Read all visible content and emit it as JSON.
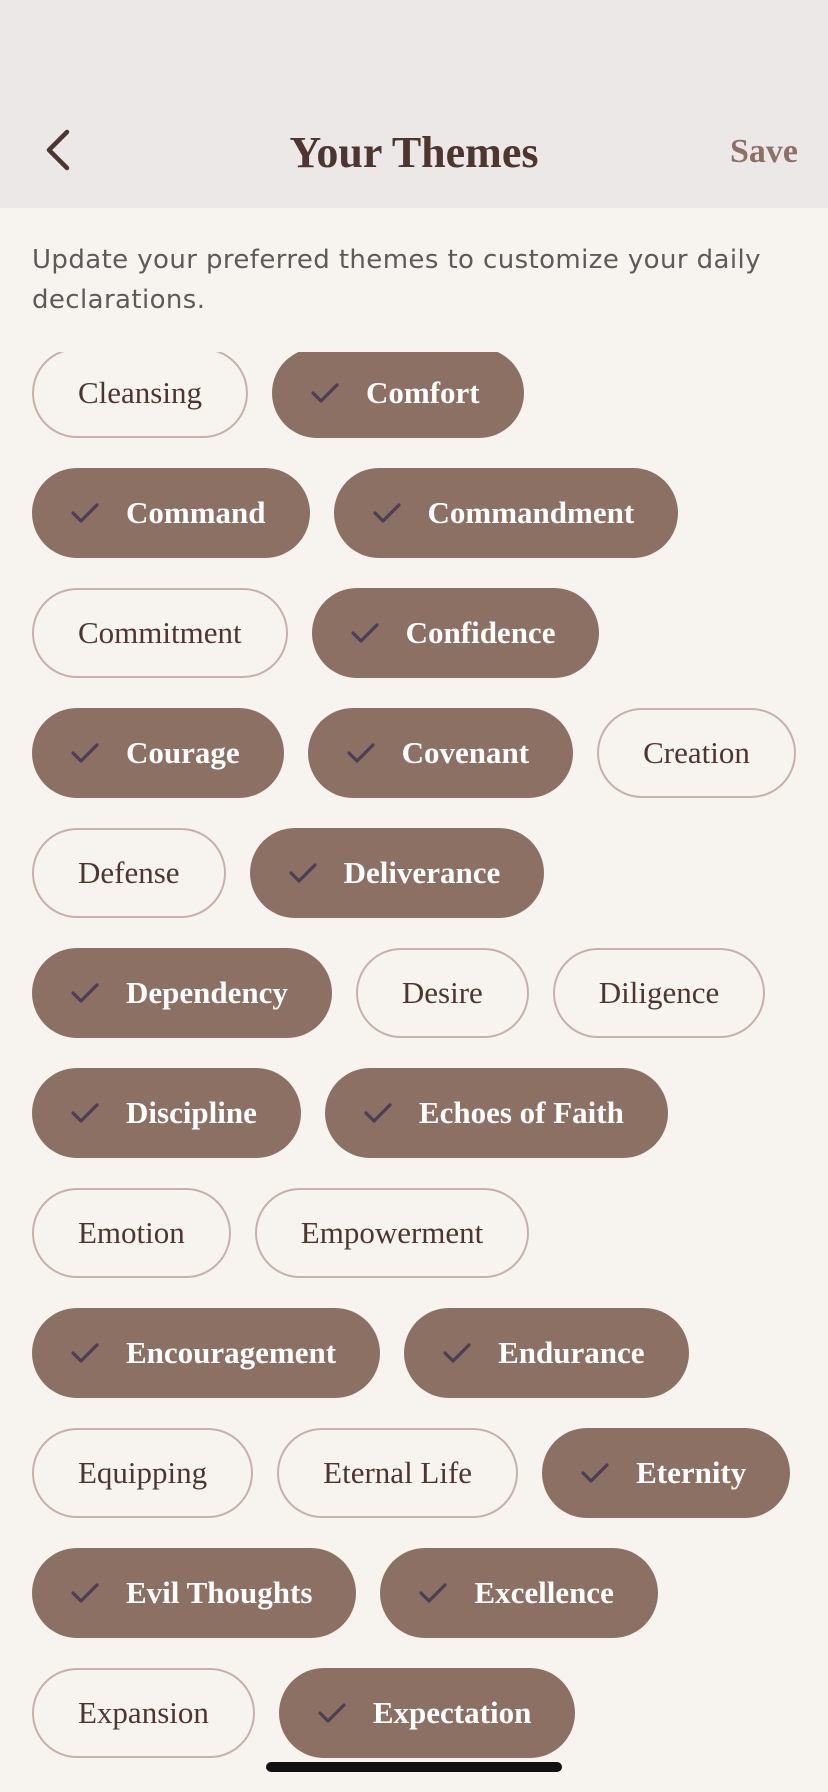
{
  "header": {
    "title": "Your Themes",
    "back_icon": "chevron-left-icon",
    "save_label": "Save"
  },
  "description": "Update your preferred themes to customize your daily declarations.",
  "colors": {
    "header_bg": "#ece8e8",
    "page_bg": "#f7f4f0",
    "selected_chip": "#8d7064",
    "check_mark": "#4a3f55",
    "title": "#4e3630",
    "save": "#8d7066"
  },
  "themes": [
    {
      "label": "Cleansing",
      "selected": false
    },
    {
      "label": "Comfort",
      "selected": true
    },
    {
      "label": "Command",
      "selected": true
    },
    {
      "label": "Commandment",
      "selected": true
    },
    {
      "label": "Commitment",
      "selected": false
    },
    {
      "label": "Confidence",
      "selected": true
    },
    {
      "label": "Courage",
      "selected": true
    },
    {
      "label": "Covenant",
      "selected": true
    },
    {
      "label": "Creation",
      "selected": false
    },
    {
      "label": "Defense",
      "selected": false
    },
    {
      "label": "Deliverance",
      "selected": true
    },
    {
      "label": "Dependency",
      "selected": true
    },
    {
      "label": "Desire",
      "selected": false
    },
    {
      "label": "Diligence",
      "selected": false
    },
    {
      "label": "Discipline",
      "selected": true
    },
    {
      "label": "Echoes of Faith",
      "selected": true
    },
    {
      "label": "Emotion",
      "selected": false
    },
    {
      "label": "Empowerment",
      "selected": false
    },
    {
      "label": "Encouragement",
      "selected": true
    },
    {
      "label": "Endurance",
      "selected": true
    },
    {
      "label": "Equipping",
      "selected": false
    },
    {
      "label": "Eternal Life",
      "selected": false
    },
    {
      "label": "Eternity",
      "selected": true
    },
    {
      "label": "Evil Thoughts",
      "selected": true
    },
    {
      "label": "Excellence",
      "selected": true
    },
    {
      "label": "Expansion",
      "selected": false
    },
    {
      "label": "Expectation",
      "selected": true
    }
  ]
}
